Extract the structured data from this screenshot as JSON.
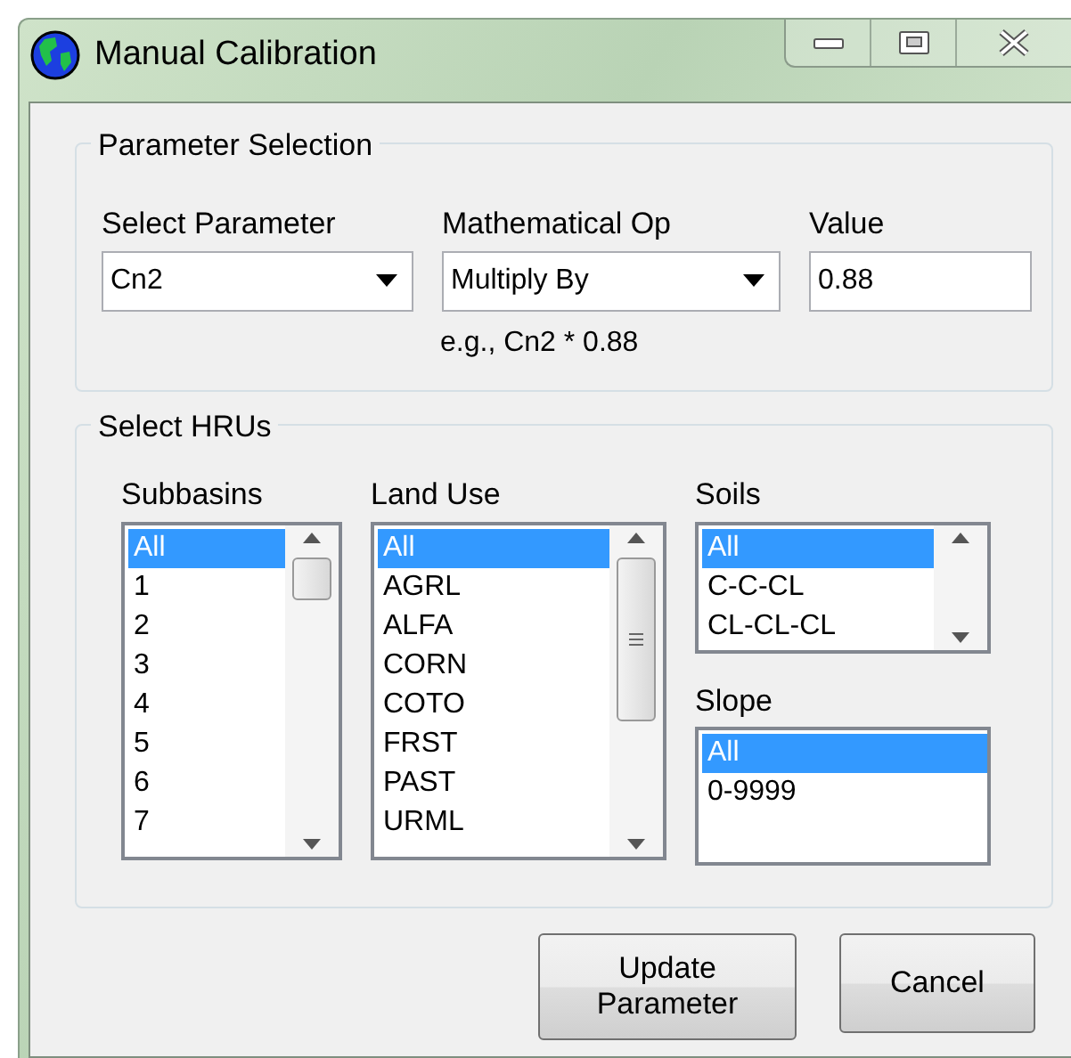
{
  "window": {
    "title": "Manual Calibration"
  },
  "parameter_selection": {
    "title": "Parameter Selection",
    "fields": [
      {
        "kind": "combo",
        "label": "Select Parameter",
        "value": "Cn2"
      },
      {
        "kind": "combo",
        "label": "Mathematical Op",
        "value": "Multiply By"
      },
      {
        "kind": "text",
        "label": "Value",
        "value": "0.88"
      }
    ],
    "example": "e.g., Cn2 * 0.88"
  },
  "select_hrus": {
    "title": "Select HRUs",
    "lists": [
      {
        "label": "Subbasins",
        "scrollbar": true,
        "items": [
          {
            "text": "All",
            "selected": true
          },
          {
            "text": "1",
            "selected": false
          },
          {
            "text": "2",
            "selected": false
          },
          {
            "text": "3",
            "selected": false
          },
          {
            "text": "4",
            "selected": false
          },
          {
            "text": "5",
            "selected": false
          },
          {
            "text": "6",
            "selected": false
          },
          {
            "text": "7",
            "selected": false
          }
        ]
      },
      {
        "label": "Land Use",
        "scrollbar": true,
        "items": [
          {
            "text": "All",
            "selected": true
          },
          {
            "text": "AGRL",
            "selected": false
          },
          {
            "text": "ALFA",
            "selected": false
          },
          {
            "text": "CORN",
            "selected": false
          },
          {
            "text": "COTO",
            "selected": false
          },
          {
            "text": "FRST",
            "selected": false
          },
          {
            "text": "PAST",
            "selected": false
          },
          {
            "text": "URML",
            "selected": false
          }
        ]
      },
      {
        "label": "Soils",
        "scrollbar": true,
        "items": [
          {
            "text": "All",
            "selected": true
          },
          {
            "text": "C-C-CL",
            "selected": false
          },
          {
            "text": "CL-CL-CL",
            "selected": false
          }
        ]
      },
      {
        "label": "Slope",
        "scrollbar": false,
        "items": [
          {
            "text": "All",
            "selected": true
          },
          {
            "text": "0-9999",
            "selected": false
          }
        ]
      }
    ]
  },
  "buttons": [
    "Update Parameter",
    "Cancel"
  ]
}
